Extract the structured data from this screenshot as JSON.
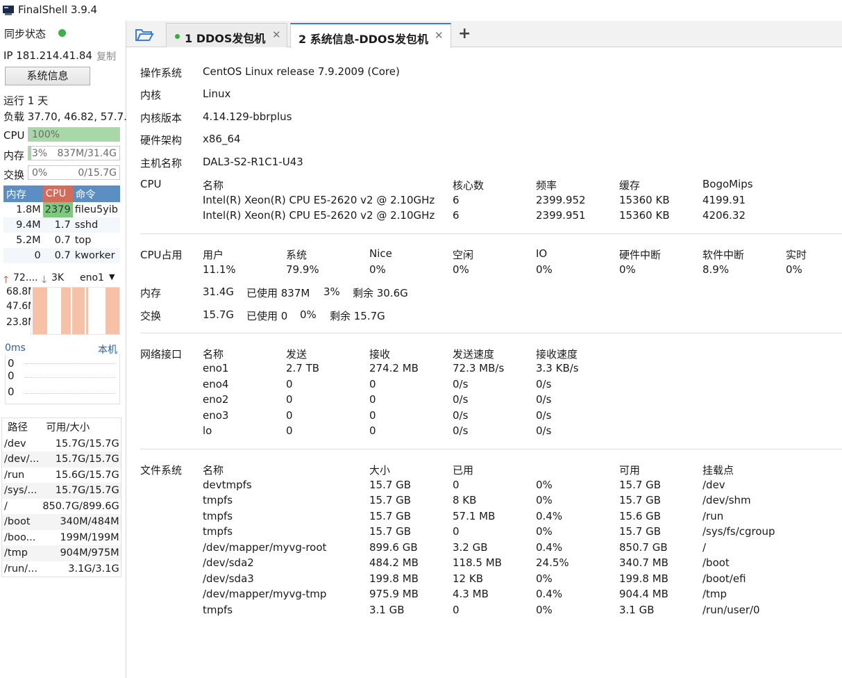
{
  "window": {
    "title": "FinalShell 3.9.4"
  },
  "sidebar": {
    "sync_label": "同步状态",
    "sync_color": "#3cb043",
    "ip_label": "IP 181.214.41.84",
    "copy_label": "复制",
    "sysinfo_button": "系统信息",
    "uptime": "运行 1 天",
    "load": "负载 37.70, 46.82, 57.7..",
    "cpu": {
      "label": "CPU",
      "text": "100%",
      "percent": 100
    },
    "mem": {
      "label": "内存",
      "text": "3%",
      "detail": "837M/31.4G",
      "percent": 3
    },
    "swap": {
      "label": "交换",
      "text": "0%",
      "detail": "0/15.7G",
      "percent": 0
    },
    "proc_headers": [
      "内存",
      "CPU",
      "命令"
    ],
    "processes": [
      {
        "mem": "1.8M",
        "cpu": "2379",
        "cmd": "fileu5yib"
      },
      {
        "mem": "9.4M",
        "cpu": "1.7",
        "cmd": "sshd"
      },
      {
        "mem": "5.2M",
        "cpu": "0.7",
        "cmd": "top"
      },
      {
        "mem": "0",
        "cpu": "0.7",
        "cmd": "kworker"
      }
    ],
    "net": {
      "up": "72....",
      "down": "3K",
      "iface": "eno1",
      "y_labels": [
        "68.8M",
        "47.6M",
        "23.8M"
      ]
    },
    "ping": {
      "latency": "0ms",
      "host": "本机",
      "values": [
        "0",
        "0",
        "0"
      ]
    },
    "disk_headers": [
      "路径",
      "可用/大小"
    ],
    "disks": [
      {
        "path": "/dev",
        "size": "15.7G/15.7G"
      },
      {
        "path": "/dev/...",
        "size": "15.7G/15.7G"
      },
      {
        "path": "/run",
        "size": "15.6G/15.7G"
      },
      {
        "path": "/sys/...",
        "size": "15.7G/15.7G"
      },
      {
        "path": "/",
        "size": "850.7G/899.6G"
      },
      {
        "path": "/boot",
        "size": "340M/484M"
      },
      {
        "path": "/boo...",
        "size": "199M/199M"
      },
      {
        "path": "/tmp",
        "size": "904M/975M"
      },
      {
        "path": "/run/...",
        "size": "3.1G/3.1G"
      }
    ]
  },
  "tabs": {
    "tab1": {
      "label": "1 DDOS发包机",
      "close": "✕"
    },
    "tab2": {
      "label": "2 系统信息-DDOS发包机",
      "close": "✕"
    },
    "add": "+"
  },
  "info": {
    "os_label": "操作系统",
    "os": "CentOS Linux release 7.9.2009 (Core)",
    "kernel_label": "内核",
    "kernel": "Linux",
    "kver_label": "内核版本",
    "kver": "4.14.129-bbrplus",
    "arch_label": "硬件架构",
    "arch": "x86_64",
    "host_label": "主机名称",
    "host": "DAL3-S2-R1C1-U43",
    "cpu_label": "CPU",
    "cpu_headers": [
      "名称",
      "核心数",
      "频率",
      "缓存",
      "BogoMips"
    ],
    "cpus": [
      [
        "Intel(R) Xeon(R) CPU E5-2620 v2 @ 2.10GHz",
        "6",
        "2399.952",
        "15360 KB",
        "4199.91"
      ],
      [
        "Intel(R) Xeon(R) CPU E5-2620 v2 @ 2.10GHz",
        "6",
        "2399.951",
        "15360 KB",
        "4206.32"
      ]
    ],
    "cpu_usage_label": "CPU占用",
    "cpu_usage_headers": [
      "用户",
      "系统",
      "Nice",
      "空闲",
      "IO",
      "硬件中断",
      "软件中断",
      "实时"
    ],
    "cpu_usage": [
      "11.1%",
      "79.9%",
      "0%",
      "0%",
      "0%",
      "0%",
      "8.9%",
      "0%"
    ],
    "mem_label": "内存",
    "mem": [
      "31.4G",
      "已使用 837M",
      "3%",
      "剩余 30.6G"
    ],
    "swap_label": "交换",
    "swap": [
      "15.7G",
      "已使用 0",
      "0%",
      "剩余 15.7G"
    ],
    "net_label": "网络接口",
    "net_headers": [
      "名称",
      "发送",
      "接收",
      "发送速度",
      "接收速度"
    ],
    "nets": [
      [
        "eno1",
        "2.7 TB",
        "274.2 MB",
        "72.3 MB/s",
        "3.3 KB/s"
      ],
      [
        "eno4",
        "0",
        "0",
        "0/s",
        "0/s"
      ],
      [
        "eno2",
        "0",
        "0",
        "0/s",
        "0/s"
      ],
      [
        "eno3",
        "0",
        "0",
        "0/s",
        "0/s"
      ],
      [
        "lo",
        "0",
        "0",
        "0/s",
        "0/s"
      ]
    ],
    "fs_label": "文件系统",
    "fs_headers": [
      "名称",
      "大小",
      "已用",
      "",
      "可用",
      "挂载点"
    ],
    "fs": [
      [
        "devtmpfs",
        "15.7 GB",
        "0",
        "0%",
        "15.7 GB",
        "/dev"
      ],
      [
        "tmpfs",
        "15.7 GB",
        "8 KB",
        "0%",
        "15.7 GB",
        "/dev/shm"
      ],
      [
        "tmpfs",
        "15.7 GB",
        "57.1 MB",
        "0.4%",
        "15.6 GB",
        "/run"
      ],
      [
        "tmpfs",
        "15.7 GB",
        "0",
        "0%",
        "15.7 GB",
        "/sys/fs/cgroup"
      ],
      [
        "/dev/mapper/myvg-root",
        "899.6 GB",
        "3.2 GB",
        "0.4%",
        "850.7 GB",
        "/"
      ],
      [
        "/dev/sda2",
        "484.2 MB",
        "118.5 MB",
        "24.5%",
        "340.7 MB",
        "/boot"
      ],
      [
        "/dev/sda3",
        "199.8 MB",
        "12 KB",
        "0%",
        "199.8 MB",
        "/boot/efi"
      ],
      [
        "/dev/mapper/myvg-tmp",
        "975.9 MB",
        "4.3 MB",
        "0.4%",
        "904.4 MB",
        "/tmp"
      ],
      [
        "tmpfs",
        "3.1 GB",
        "0",
        "0%",
        "3.1 GB",
        "/run/user/0"
      ]
    ]
  }
}
